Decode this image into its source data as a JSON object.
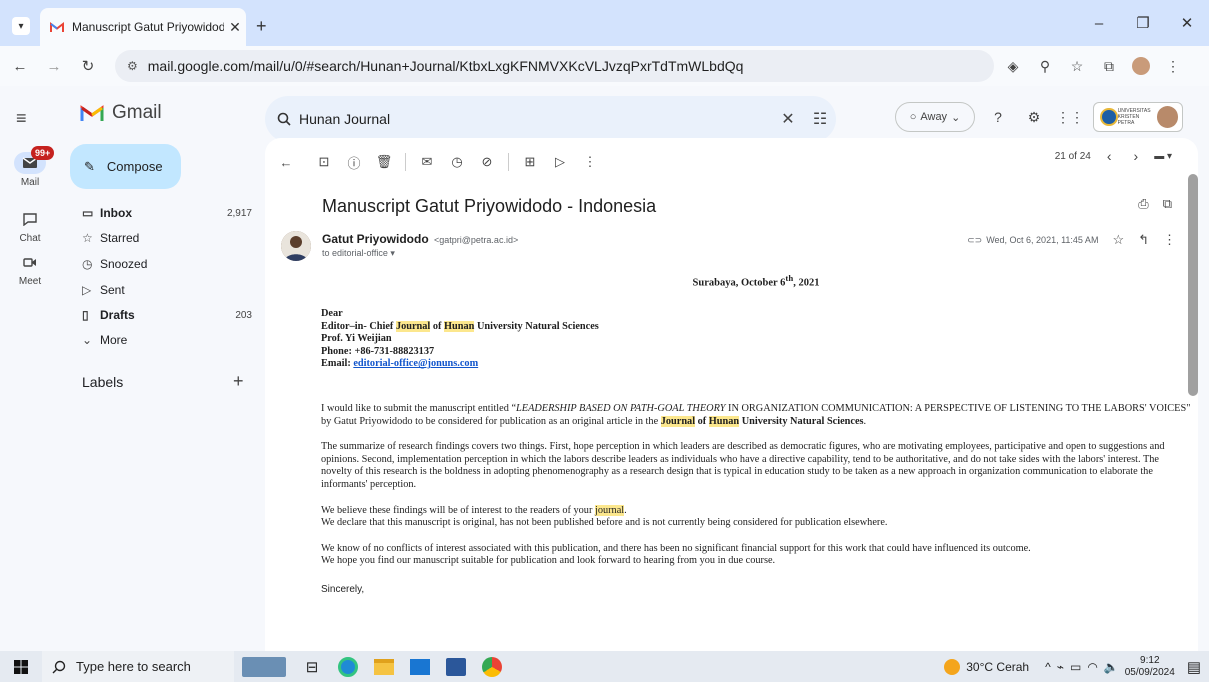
{
  "browser": {
    "tab_title": "Manuscript Gatut Priyowidodo",
    "url_host": "mail.google.com",
    "url_path": "/mail/u/0/#search/Hunan+Journal/KtbxLxgKFNMVXKcVLJvzqPxrTdTmWLbdQq"
  },
  "gmail": {
    "brand": "Gmail",
    "rail": {
      "mail_label": "Mail",
      "mail_badge": "99+",
      "chat_label": "Chat",
      "meet_label": "Meet"
    },
    "compose_label": "Compose",
    "nav": [
      {
        "label": "Inbox",
        "count": "2,917"
      },
      {
        "label": "Starred",
        "count": ""
      },
      {
        "label": "Snoozed",
        "count": ""
      },
      {
        "label": "Sent",
        "count": ""
      },
      {
        "label": "Drafts",
        "count": "203"
      },
      {
        "label": "More",
        "count": ""
      }
    ],
    "labels_heading": "Labels",
    "search_query": "Hunan Journal",
    "status": "Away",
    "org_name": "UNIVERSITAS KRISTEN PETRA",
    "pager": "21 of 24"
  },
  "email": {
    "subject": "Manuscript Gatut Priyowidodo - Indonesia",
    "sender_name": "Gatut Priyowidodo",
    "sender_addr": "<gatpri@petra.ac.id>",
    "to_line": "to editorial-office",
    "datetime": "Wed, Oct 6, 2021, 11:45 AM",
    "dateline_pre": "Surabaya, October 6",
    "dateline_sup": "th",
    "dateline_post": ", 2021",
    "greeting": "Dear",
    "addr_line2_pre": "Editor–in- Chief ",
    "hl_journal": "Journal",
    "word_of": " of ",
    "hl_hunan": "Hunan",
    "addr_line2_post": " University Natural Sciences",
    "addr_line3": "Prof. Yi Weijian",
    "addr_line4": "Phone: +86-731-88823137",
    "addr_email_label": "Email: ",
    "addr_email": "editorial-office@jonuns.com",
    "p1_a": "I would like to submit the manuscript entitled “",
    "p1_italic": "LEADERSHIP BASED ON PATH-GOAL THEORY",
    "p1_b": " IN ORGANIZATION COMMUNICATION: A PERSPECTIVE OF LISTENING TO THE LABORS' VOICES\" by Gatut Priyowidodo to be considered for publication as   an original article in the ",
    "p1_c": " University Natural Sciences",
    "p1_end": ".",
    "p2": "The summarize of research findings covers two things. First, hope perception in which leaders are described as democratic figures, who are motivating employees, participative and open to suggestions and opinions. Second, implementation perception in which the labors describe leaders as individuals who have a directive capability, tend to be authoritative, and do not take sides with the labors' interest. The novelty of this research is the boldness in adopting phenomenography as a research design that is typical in education study to be taken as a new approach in organization communication to elaborate the informants' perception.",
    "p3_a": "We believe these findings will be of interest to the readers of your ",
    "p3_hl": "journal",
    "p3_b": ".",
    "p3_line2": "We declare that this manuscript is original, has not been published before and is not currently being considered for publication elsewhere.",
    "p4_line1": "We know of no conflicts of interest associated with this publication, and there has been no significant financial support for this work that could have influenced its outcome.",
    "p4_line2": "We hope you find our manuscript suitable for publication and look forward to hearing from you in due course.",
    "closing": "Sincerely,"
  },
  "taskbar": {
    "search_placeholder": "Type here to search",
    "weather": "30°C  Cerah",
    "time": "9:12",
    "date": "05/09/2024"
  },
  "colors": {
    "accent": "#c2e7ff",
    "highlight": "#fce78d",
    "badge": "#c5221f",
    "gmail_red": "#ea4335"
  }
}
